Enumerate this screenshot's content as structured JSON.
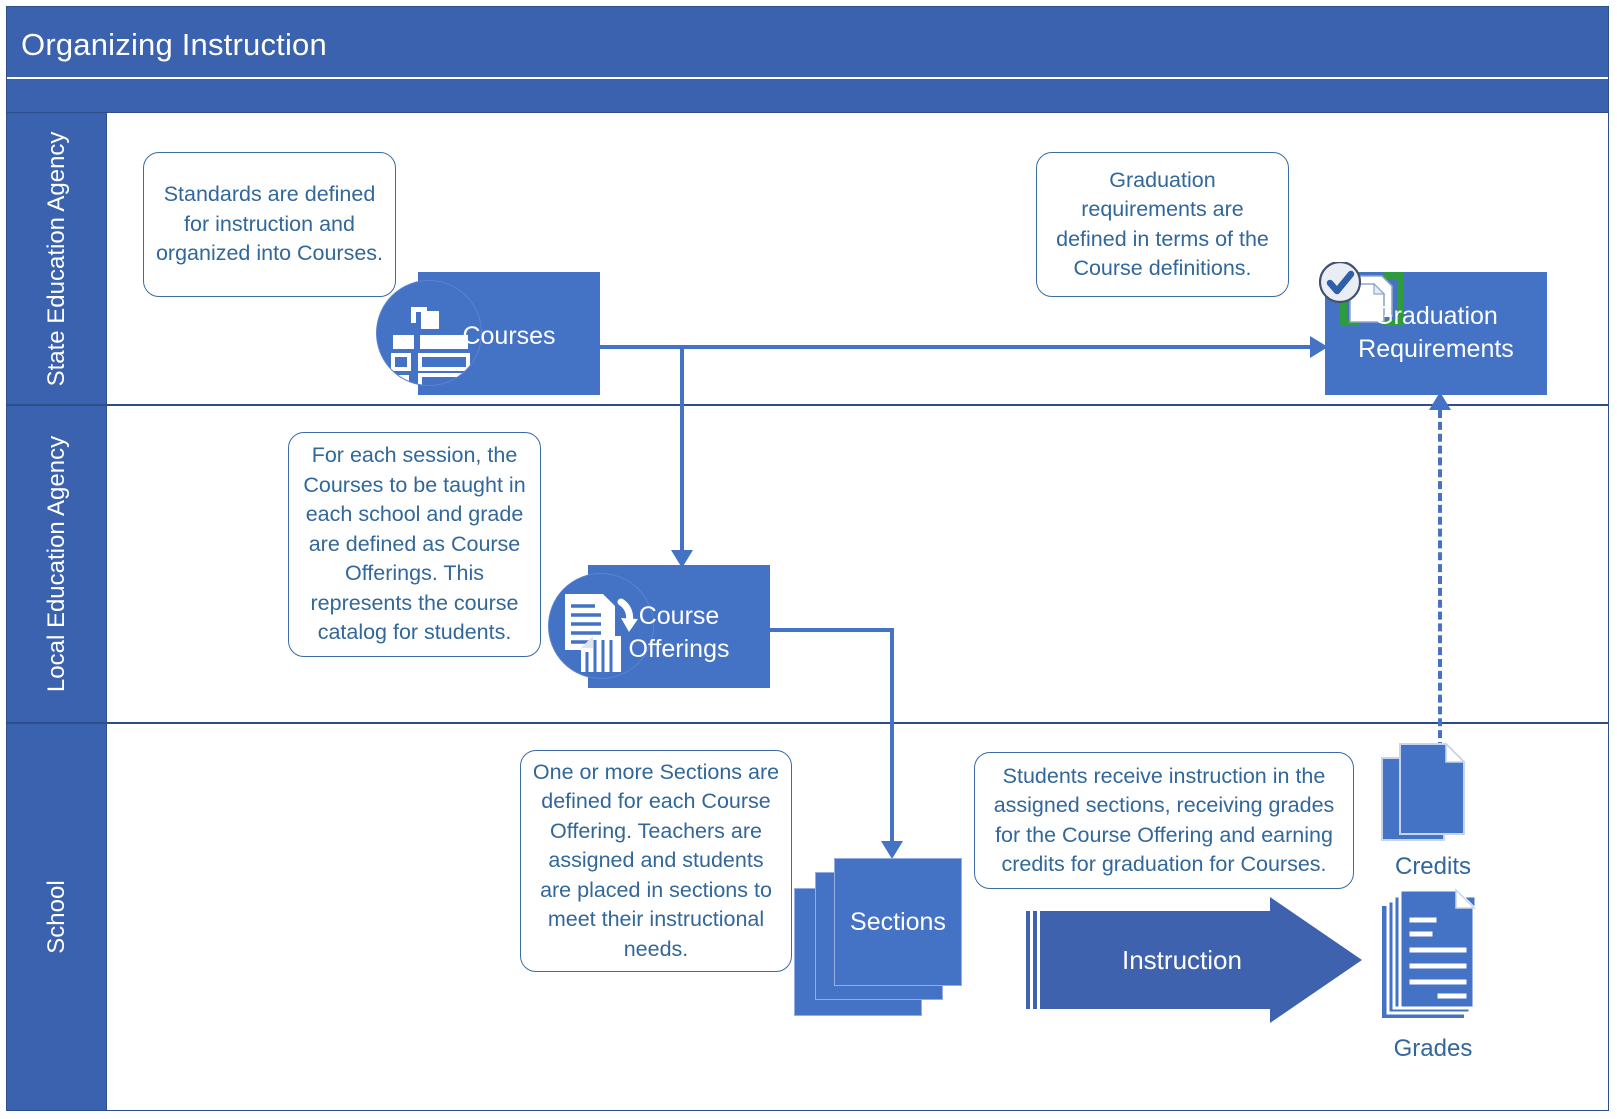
{
  "header": {
    "title": "Organizing Instruction"
  },
  "lanes": [
    {
      "label": "State Education Agency"
    },
    {
      "label": "Local Education Agency"
    },
    {
      "label": "School"
    }
  ],
  "callouts": [
    {
      "id": "standards",
      "text": "Standards are defined for instruction and organized into Courses."
    },
    {
      "id": "grad-reqs",
      "text": "Graduation requirements are defined in terms of the Course definitions."
    },
    {
      "id": "course-offerings",
      "text": "For each session, the Courses to be taught in each school and grade are defined as Course Offerings.  This represents the course catalog for students."
    },
    {
      "id": "sections",
      "text": "One or more Sections are defined for each Course Offering. Teachers are assigned and students are placed in sections to meet their instructional needs."
    },
    {
      "id": "instruction",
      "text": "Students receive instruction in the assigned sections, receiving grades for the Course Offering and earning credits for graduation for Courses."
    }
  ],
  "nodes": {
    "courses": {
      "label": "Courses",
      "icon": "course-list-icon"
    },
    "graduation_requirements": {
      "label": "Graduation\nRequirements",
      "icon": "checked-documents-icon"
    },
    "course_offerings": {
      "label": "Course\nOfferings",
      "icon": "documents-refresh-icon"
    },
    "sections": {
      "label": "Sections",
      "icon": "stacked-cards-icon"
    },
    "instruction": {
      "label": "Instruction",
      "icon": "block-arrow-icon"
    },
    "credits": {
      "label": "Credits",
      "icon": "document-stack-icon"
    },
    "grades": {
      "label": "Grades",
      "icon": "lined-document-stack-icon"
    }
  },
  "colors": {
    "header_blue": "#3B62AE",
    "node_blue": "#4472C4",
    "arrow_blue": "#4472C4",
    "instruction_blue": "#3E62AD",
    "callout_text": "#31679B",
    "callout_border": "#3A6BA5",
    "bracket_green": "#2E9B3E",
    "frame_border": "#2C4F8C"
  }
}
